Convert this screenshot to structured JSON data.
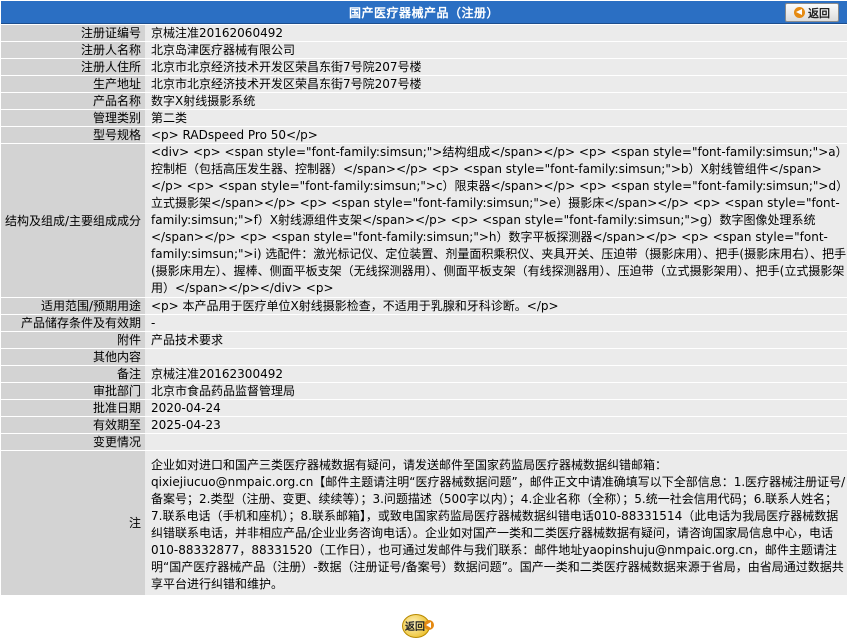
{
  "header": {
    "title": "国产医疗器械产品（注册）",
    "back_label": "返回"
  },
  "rows": [
    {
      "label": "注册证编号",
      "value": "京械注准20162060492"
    },
    {
      "label": "注册人名称",
      "value": "北京岛津医疗器械有限公司"
    },
    {
      "label": "注册人住所",
      "value": "北京市北京经济技术开发区荣昌东街7号院207号楼"
    },
    {
      "label": "生产地址",
      "value": "北京市北京经济技术开发区荣昌东街7号院207号楼"
    },
    {
      "label": "产品名称",
      "value": "数字X射线摄影系统"
    },
    {
      "label": "管理类别",
      "value": "第二类"
    },
    {
      "label": "型号规格",
      "value": "<p> RADspeed Pro 50</p>"
    }
  ],
  "structure": {
    "label": "结构及组成/主要组成成分",
    "value": "<div> <p> <span style=\"font-family:simsun;\">结构组成</span></p> <p> <span style=\"font-family:simsun;\">a）控制柜（包括高压发生器、控制器）</span></p> <p> <span style=\"font-family:simsun;\">b）X射线管组件</span></p> <p> <span style=\"font-family:simsun;\">c）限束器</span></p> <p> <span style=\"font-family:simsun;\">d）立式摄影架</span></p> <p> <span style=\"font-family:simsun;\">e）摄影床</span></p> <p> <span style=\"font-family:simsun;\">f）X射线源组件支架</span></p> <p> <span style=\"font-family:simsun;\">g）数字图像处理系统</span></p> <p> <span style=\"font-family:simsun;\">h）数字平板探测器</span></p> <p> <span style=\"font-family:simsun;\">i) 选配件：激光标记仪、定位装置、剂量面积乘积仪、夹具开关、压迫带（摄影床用）、把手(摄影床用右）、把手(摄影床用左）、握棒、侧面平板支架（无线探测器用）、侧面平板支架（有线探测器用）、压迫带（立式摄影架用）、把手(立式摄影架用）</span></p></div> <p> "
  },
  "rows2": [
    {
      "label": "适用范围/预期用途",
      "value": "<p> 本产品用于医疗单位X射线摄影检查，不适用于乳腺和牙科诊断。</p>"
    },
    {
      "label": "产品储存条件及有效期",
      "value": "-"
    },
    {
      "label": "附件",
      "value": "产品技术要求"
    },
    {
      "label": "其他内容",
      "value": ""
    },
    {
      "label": "备注",
      "value": "京械注准20162300492"
    },
    {
      "label": "审批部门",
      "value": "北京市食品药品监督管理局"
    },
    {
      "label": "批准日期",
      "value": "2020-04-24"
    },
    {
      "label": "有效期至",
      "value": "2025-04-23"
    },
    {
      "label": "变更情况",
      "value": ""
    }
  ],
  "note": {
    "label": "注",
    "paragraphs": [
      "企业如对进口和国产三类医疗器械数据有疑问，请发送邮件至国家药监局医疗器械数据纠错邮箱：",
      "qixiejiucuo@nmpaic.org.cn【邮件主题请注明“医疗器械数据问题”，邮件正文中请准确填写以下全部信息：1.医疗器械注册证号/备案号；2.类型（注册、变更、续续等）；3.问题描述（500字以内）；4.企业名称（全称）；5.统一社会信用代码；6.联系人姓名；7.联系电话（手机和座机）；8.联系邮箱】，或致电国家药监局医疗器械数据纠错电话010-88331514（此电话为我局医疗器械数据纠错联系电话，并非相应产品/企业业务咨询电话）。企业如对国产一类和二类医疗器械数据有疑问，请咨询国家局信息中心，电话010-88332877，88331520（工作日），也可通过发邮件与我们联系：邮件地址yaopinshuju@nmpaic.org.cn，邮件主题请注明“国产医疗器械产品（注册）-数据（注册证号/备案号）数据问题”。国产一类和二类医疗器械数据来源于省局，由省局通过数据共享平台进行纠错和维护。"
    ]
  },
  "footer": {
    "back_label": "返回"
  },
  "colors": {
    "header_bg": "#2b6fc3",
    "label_bg": "#d3d3d3",
    "value_bg": "#ebebeb",
    "accent": "#e58a12"
  }
}
